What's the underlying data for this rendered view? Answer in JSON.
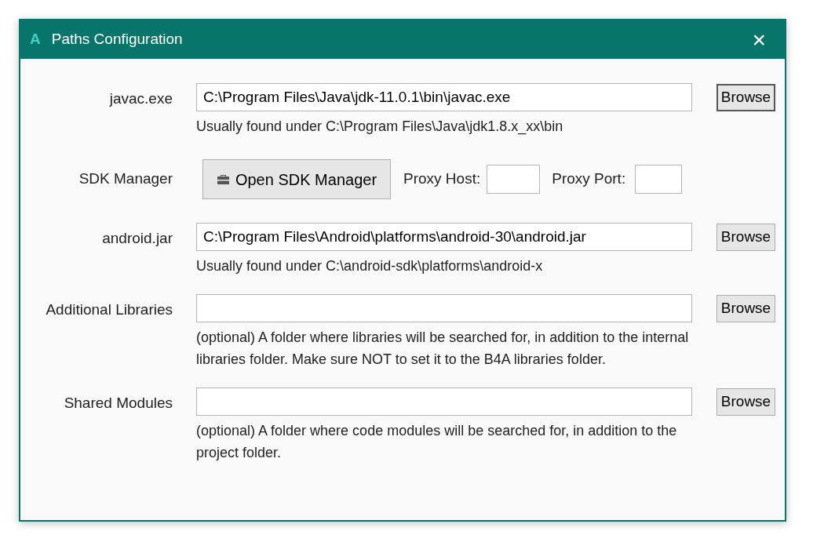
{
  "window": {
    "icon_letter": "A",
    "title": "Paths Configuration",
    "close": "×"
  },
  "rows": [
    {
      "kind": "path",
      "label": "javac.exe",
      "value": "C:\\Program Files\\Java\\jdk-11.0.1\\bin\\javac.exe",
      "button": "Browse",
      "focused": true,
      "hint": "Usually found under C:\\Program Files\\Java\\jdk1.8.x_xx\\bin"
    },
    {
      "kind": "sdk",
      "label": "SDK Manager",
      "button": "Open SDK Manager",
      "proxy_host_label": "Proxy Host:",
      "proxy_port_label": "Proxy Port:"
    },
    {
      "kind": "path",
      "label": "android.jar",
      "value": "C:\\Program Files\\Android\\platforms\\android-30\\android.jar",
      "button": "Browse",
      "focused": false,
      "hint": "Usually found under C:\\android-sdk\\platforms\\android-x"
    },
    {
      "kind": "path",
      "label": "Additional Libraries",
      "button": "Browse",
      "focused": false,
      "hint": "(optional) A folder where libraries will be searched for, in addition to the internal libraries folder. Make sure NOT to set it to the B4A libraries folder."
    },
    {
      "kind": "path",
      "label": "Shared Modules",
      "button": "Browse",
      "focused": false,
      "hint": "(optional) A folder where code modules will be searched for, in addition to the project folder."
    }
  ]
}
